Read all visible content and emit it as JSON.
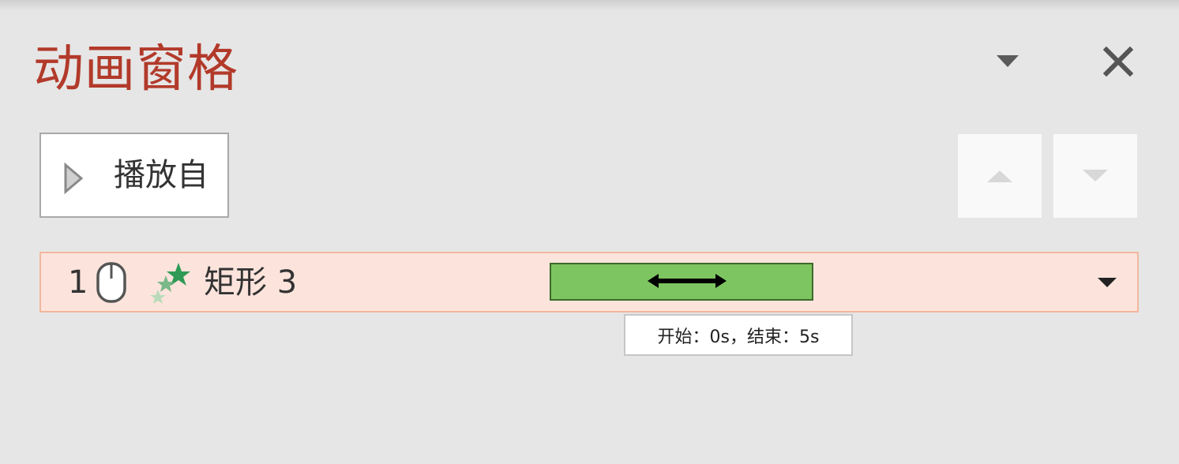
{
  "pane": {
    "title": "动画窗格",
    "icons": {
      "options": "caret-down-icon",
      "close": "close-icon"
    }
  },
  "toolbar": {
    "play_label": "播放自",
    "play_icon": "play-triangle-icon",
    "move_up_icon": "move-up-icon",
    "move_down_icon": "move-down-icon"
  },
  "animations": [
    {
      "sequence": "1",
      "trigger_icon": "mouse-icon",
      "effect_icon": "emphasis-stars-icon",
      "name": "矩形 3",
      "bar_color": "#7dc560",
      "tooltip": "开始：0s，结束：5s"
    }
  ],
  "colors": {
    "title": "#b23a2a",
    "row_bg": "#fce4dc",
    "row_border": "#f3b79f",
    "bar": "#7dc560"
  }
}
